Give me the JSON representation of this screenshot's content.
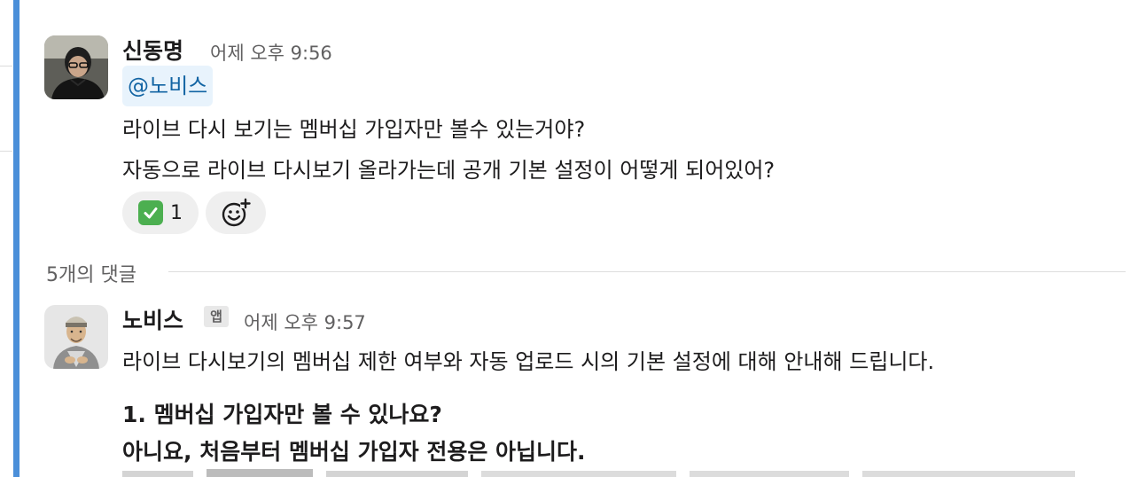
{
  "message1": {
    "author": "신동명",
    "time": "어제 오후 9:56",
    "mention": "@노비스",
    "lines": [
      "라이브 다시 보기는 멤버십 가입자만 볼수 있는거야?",
      "자동으로 라이브 다시보기 올라가는데 공개 기본 설정이 어떻게 되어있어?"
    ],
    "reactions": [
      {
        "emoji": "white-check-mark",
        "count": "1"
      }
    ],
    "add_reaction_icon": "add-reaction-icon"
  },
  "thread": {
    "replies_label": "5개의 댓글"
  },
  "message2": {
    "author": "노비스",
    "badge": "앱",
    "time": "어제 오후 9:57",
    "intro": "라이브 다시보기의 멤버십 제한 여부와 자동 업로드 시의 기본 설정에 대해 안내해 드립니다.",
    "heading": "1. 멤버십 가입자만 볼 수 있나요?",
    "answer": "아니요, 처음부터 멤버십 가입자 전용은 아닙니다."
  },
  "colors": {
    "rail": "#4b8fd9",
    "mention_bg": "#e8f3fc",
    "mention_text": "#1264a3",
    "reaction_bg": "#efefef",
    "check": "#4caf50"
  }
}
